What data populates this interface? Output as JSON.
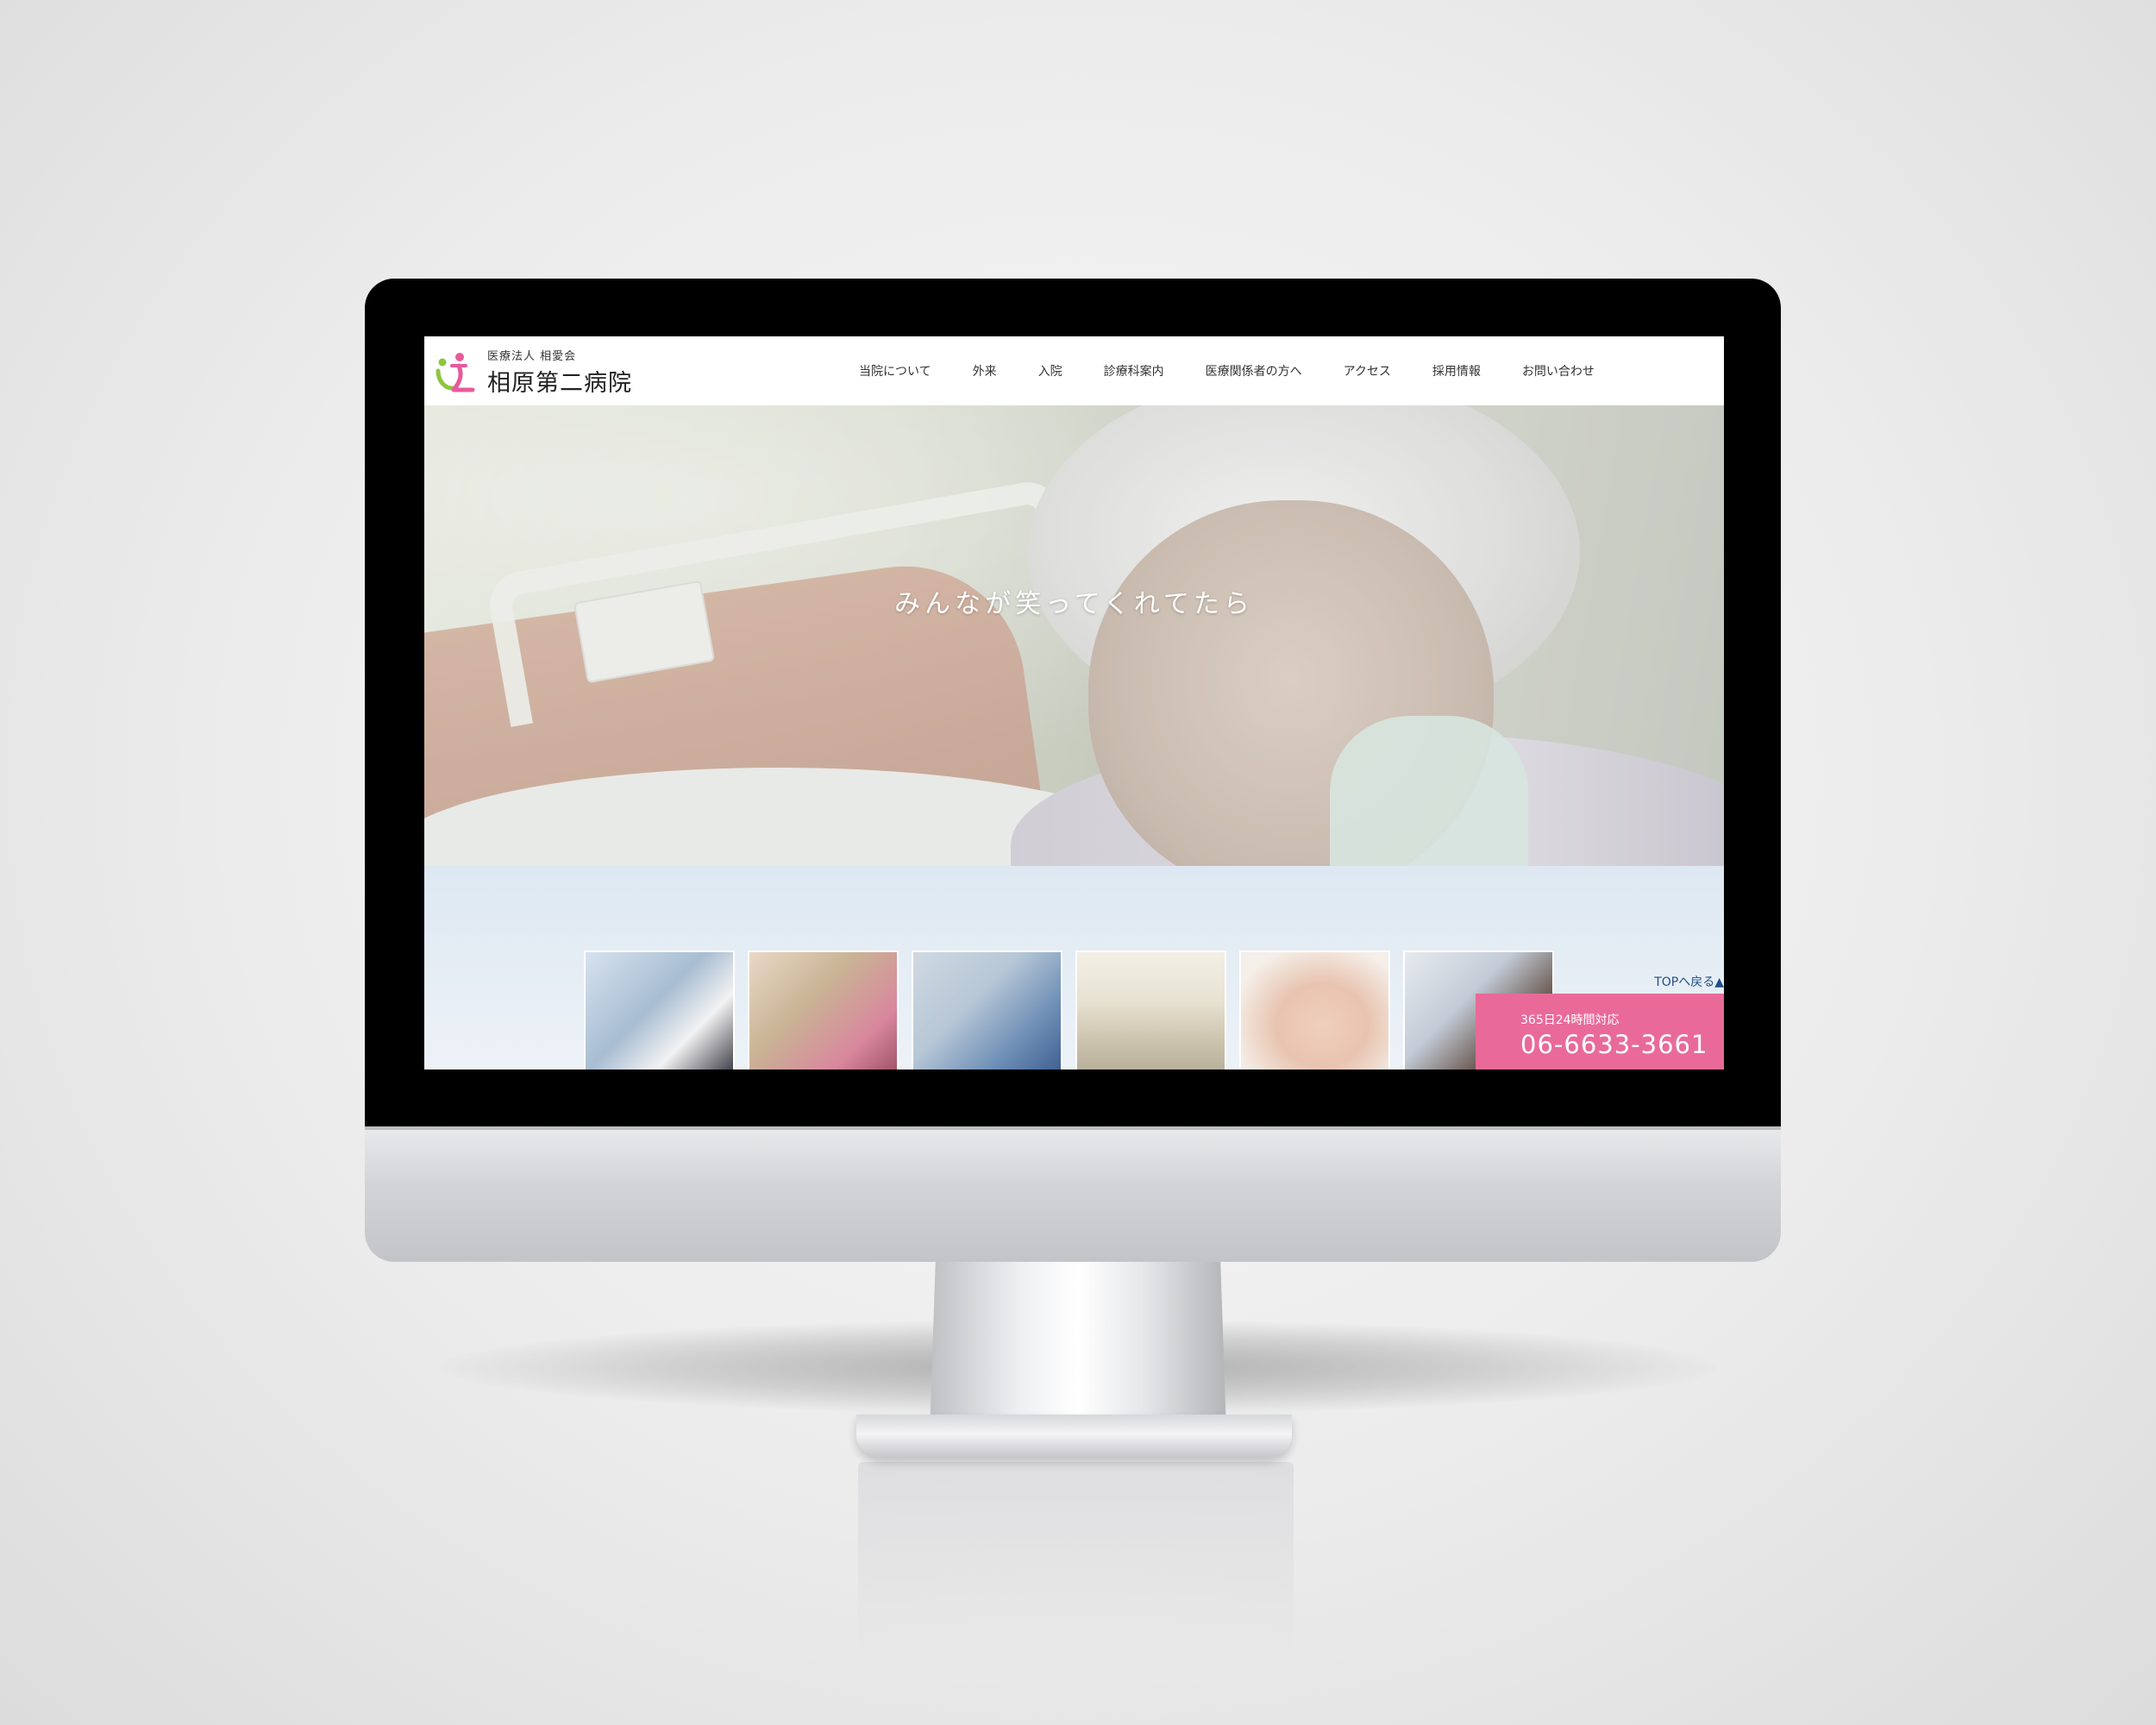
{
  "header": {
    "logo_sub": "医療法人 相愛会",
    "logo_main": "相原第二病院"
  },
  "nav": {
    "items": [
      "当院について",
      "外来",
      "入院",
      "診療科案内",
      "医療関係者の方へ",
      "アクセス",
      "採用情報",
      "お問い合わせ"
    ]
  },
  "hero": {
    "tagline": "みんなが笑ってくれてたら"
  },
  "lower": {
    "top_link": "TOPへ戻る▲",
    "phone_note": "365日24時間対応",
    "phone_number": "06-6633-3661"
  },
  "colors": {
    "accent_pink": "#e96a99",
    "logo_green": "#8cc63f",
    "logo_pink": "#e85a9a",
    "link_blue": "#1f4f86"
  },
  "icons": {
    "logo": "hospital-logo-icon"
  }
}
